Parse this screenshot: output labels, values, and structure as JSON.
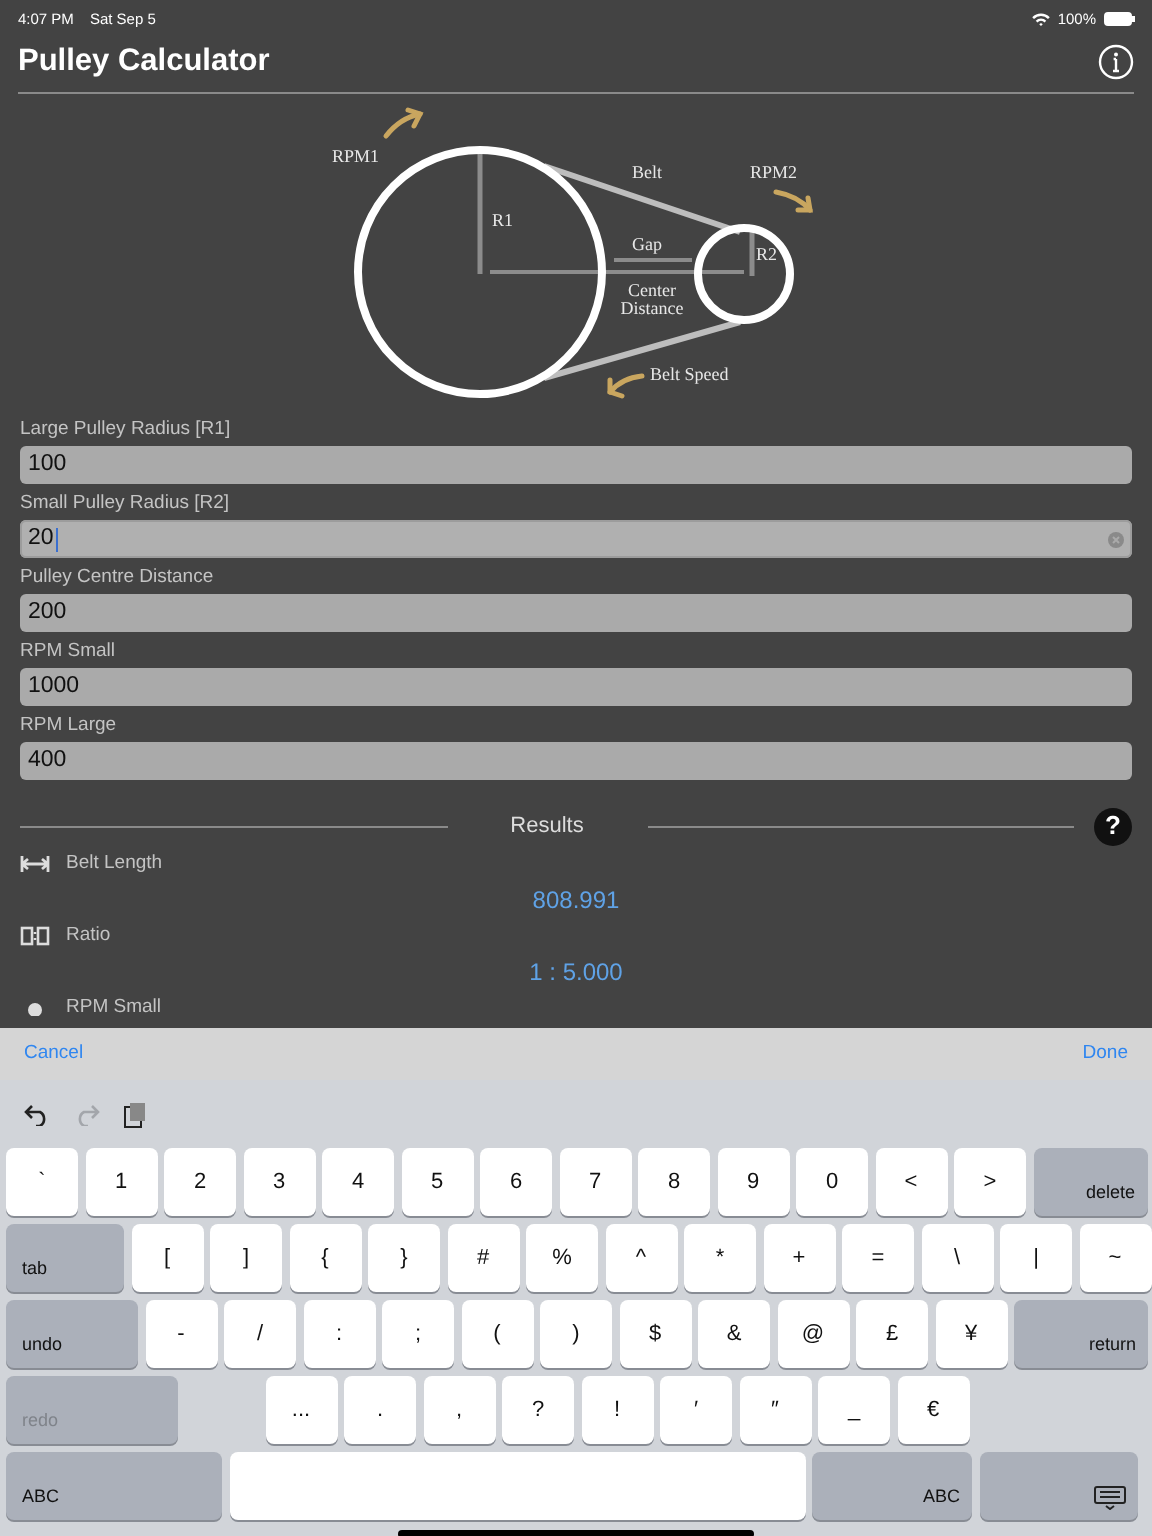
{
  "status_bar": {
    "time": "4:07 PM",
    "date": "Sat Sep 5",
    "battery": "100%"
  },
  "header": {
    "title": "Pulley Calculator"
  },
  "diagram": {
    "labels": [
      {
        "kind": "rpm1",
        "text": "RPM1"
      },
      {
        "kind": "belt",
        "text": "Belt"
      },
      {
        "kind": "rpm2",
        "text": "RPM2"
      },
      {
        "kind": "r1",
        "text": "R1"
      },
      {
        "kind": "gap",
        "text": "Gap"
      },
      {
        "kind": "r2",
        "text": "R2"
      },
      {
        "kind": "center1",
        "text": "Center"
      },
      {
        "kind": "center2",
        "text": "Distance"
      },
      {
        "kind": "speed",
        "text": "Belt Speed"
      }
    ]
  },
  "fields": [
    {
      "label": "Large Pulley Radius [R1]",
      "value": "100",
      "focused": false
    },
    {
      "label": "Small Pulley Radius [R2]",
      "value": "20",
      "focused": true
    },
    {
      "label": "Pulley Centre Distance",
      "value": "200",
      "focused": false
    },
    {
      "label": "RPM Small",
      "value": "1000",
      "focused": false
    },
    {
      "label": "RPM Large",
      "value": "400",
      "focused": false
    }
  ],
  "results": {
    "title": "Results",
    "help": "?",
    "items": [
      {
        "kind": "length",
        "label": "Belt Length",
        "value": "808.991"
      },
      {
        "kind": "ratio",
        "label": "Ratio",
        "value": "1 : 5.000"
      },
      {
        "kind": "rpm",
        "label": "RPM Small"
      }
    ]
  },
  "accessory_bar": {
    "cancel": "Cancel",
    "done": "Done"
  },
  "toolbar": [
    {
      "kind": "undo",
      "disabled": false
    },
    {
      "kind": "redo",
      "disabled": true
    },
    {
      "kind": "paste",
      "disabled": false
    }
  ],
  "keyboard": [
    [
      {
        "label": "`",
        "kind": "char"
      },
      {
        "label": "1",
        "kind": "char"
      },
      {
        "label": "2",
        "kind": "char"
      },
      {
        "label": "3",
        "kind": "char"
      },
      {
        "label": "4",
        "kind": "char"
      },
      {
        "label": "5",
        "kind": "char"
      },
      {
        "label": "6",
        "kind": "char"
      },
      {
        "label": "7",
        "kind": "char"
      },
      {
        "label": "8",
        "kind": "char"
      },
      {
        "label": "9",
        "kind": "char"
      },
      {
        "label": "0",
        "kind": "char"
      },
      {
        "label": "<",
        "kind": "char"
      },
      {
        "label": ">",
        "kind": "char"
      },
      {
        "label": "delete",
        "kind": "function",
        "disabled": false
      }
    ],
    [
      {
        "label": "tab",
        "kind": "function",
        "disabled": false
      },
      {
        "label": "[",
        "kind": "char"
      },
      {
        "label": "]",
        "kind": "char"
      },
      {
        "label": "{",
        "kind": "char"
      },
      {
        "label": "}",
        "kind": "char"
      },
      {
        "label": "#",
        "kind": "char"
      },
      {
        "label": "%",
        "kind": "char"
      },
      {
        "label": "^",
        "kind": "char"
      },
      {
        "label": "*",
        "kind": "char"
      },
      {
        "label": "+",
        "kind": "char"
      },
      {
        "label": "=",
        "kind": "char"
      },
      {
        "label": "\\",
        "kind": "char"
      },
      {
        "label": "|",
        "kind": "char"
      },
      {
        "label": "~",
        "kind": "char"
      }
    ],
    [
      {
        "label": "undo",
        "kind": "function",
        "disabled": false
      },
      {
        "label": "-",
        "kind": "char"
      },
      {
        "label": "/",
        "kind": "char"
      },
      {
        "label": ":",
        "kind": "char"
      },
      {
        "label": ";",
        "kind": "char"
      },
      {
        "label": "(",
        "kind": "char"
      },
      {
        "label": ")",
        "kind": "char"
      },
      {
        "label": "$",
        "kind": "char"
      },
      {
        "label": "&",
        "kind": "char"
      },
      {
        "label": "@",
        "kind": "char"
      },
      {
        "label": "£",
        "kind": "char"
      },
      {
        "label": "¥",
        "kind": "char"
      },
      {
        "label": "return",
        "kind": "function",
        "disabled": false
      }
    ],
    [
      {
        "label": "redo",
        "kind": "function",
        "disabled": true
      },
      {
        "label": "...",
        "kind": "char"
      },
      {
        "label": ".",
        "kind": "char"
      },
      {
        "label": ",",
        "kind": "char"
      },
      {
        "label": "?",
        "kind": "char"
      },
      {
        "label": "!",
        "kind": "char"
      },
      {
        "label": "′",
        "kind": "char"
      },
      {
        "label": "″",
        "kind": "char"
      },
      {
        "label": "_",
        "kind": "char"
      },
      {
        "label": "€",
        "kind": "char"
      }
    ],
    [
      {
        "label": "ABC",
        "kind": "function",
        "disabled": false
      },
      {
        "kind": "space"
      },
      {
        "label": "ABC",
        "kind": "function",
        "disabled": false
      },
      {
        "kind": "dismiss"
      }
    ]
  ]
}
